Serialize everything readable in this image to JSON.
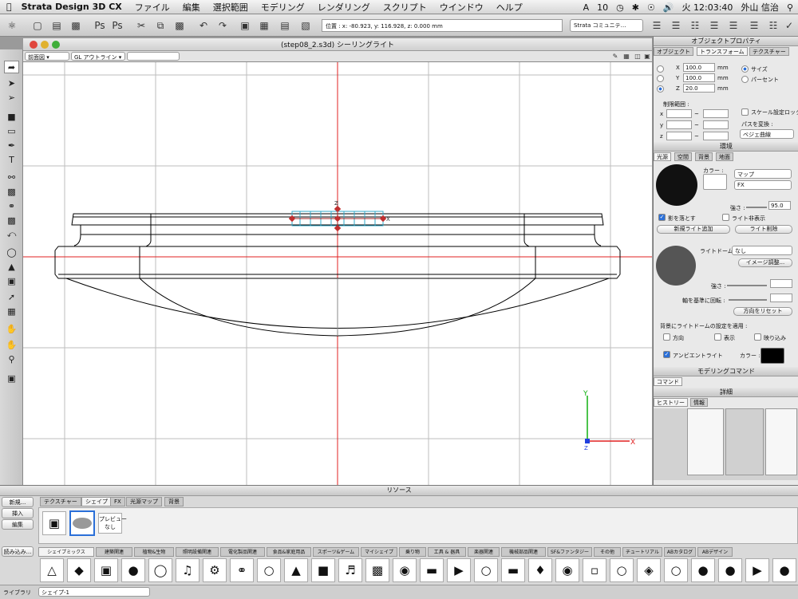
{
  "menubar": {
    "app": "Strata Design 3D CX",
    "items": [
      "ファイル",
      "編集",
      "選択範囲",
      "モデリング",
      "レンダリング",
      "スクリプト",
      "ウインドウ",
      "ヘルプ"
    ],
    "adobe_count": "10",
    "clock": "火 12:03:40",
    "user": "外山 信治"
  },
  "toolbar": {
    "coords": "位置 : x: -80.923, y: 116.928, z: 0.000 mm",
    "community": "Strata コミュニテ…"
  },
  "view_window": {
    "title": "(step08_2.s3d) シーリングライト",
    "view_select": "前面図",
    "render_select": "GL アウトライン"
  },
  "viewport": {
    "axis_labels": {
      "y": "Y",
      "z": "Z",
      "x": "X"
    }
  },
  "object_panel": {
    "title": "オブジェクトプロパティ",
    "tabs": [
      "オブジェクト",
      "トランスフォーム",
      "テクスチャー"
    ],
    "x_value": "100.0",
    "y_value": "100.0",
    "z_value": "20.0",
    "unit": "mm",
    "size_label": "サイズ",
    "percent_label": "パーセント",
    "limit_label": "制限範囲 :",
    "axis_x": "x",
    "axis_y": "y",
    "axis_z": "z",
    "tilde": "~",
    "scale_lock": "スケール設定ロック",
    "path_transform": "パスを変換 :",
    "path_value": "ベジェ曲線"
  },
  "env_panel": {
    "title": "環境",
    "tabs": [
      "光源",
      "空間",
      "背景",
      "地面"
    ],
    "color_label": "カラー :",
    "map_select": "マップ",
    "fx_select": "FX",
    "intensity_label": "強さ :",
    "intensity_value": "95.0",
    "cast_shadow": "影を落とす",
    "show_light": "ライト非表示",
    "add_light": "新規ライト追加",
    "delete_light": "ライト削除",
    "light_dome_label": "ライトドーム :",
    "light_dome_value": "なし",
    "image_adjust": "イメージ調整...",
    "strength2_label": "強さ :",
    "rotate_label": "軸を基準に回転 :",
    "reset_dir": "方向をリセット",
    "bg_dome_label": "背景にライトドームの設定を適用 :",
    "opt_dir": "方向",
    "opt_show": "表示",
    "opt_crop": "映り込み",
    "ambient": "アンビエントライト",
    "ambient_color": "カラー :"
  },
  "modeling_panel": {
    "title": "モデリングコマンド",
    "tab": "コマンド",
    "detail_title": "詳細",
    "tabs": [
      "ヒストリー",
      "情報"
    ]
  },
  "resources": {
    "title": "リソース",
    "tabs": [
      "テクスチャー",
      "シェイプ",
      "FX",
      "光源マップ",
      "背景"
    ],
    "side_buttons": [
      "新規...",
      "挿入",
      "編集",
      "読み込み..."
    ],
    "preview": "プレビュー\nなし",
    "category_tabs": [
      "シェイプミックス",
      "建築関連",
      "植物&生物",
      "照明設備関連",
      "電化製品関連",
      "食品&家庭用品",
      "スポーツ&ゲーム",
      "マイシェイプ",
      "乗り物",
      "工具 & 器具",
      "楽器関連",
      "機械部品関連",
      "SF&ファンタジー",
      "その他",
      "チュートリアル",
      "ABカタログ",
      "ABデザイン"
    ],
    "library_label": "ライブラリ",
    "library_value": "シェイプ-1"
  },
  "colors": {
    "accent": "#2a6fd8",
    "axis_red": "#e02020",
    "axis_green": "#10b010",
    "axis_blue": "#2040e0",
    "cursor": "#30a8c8"
  }
}
